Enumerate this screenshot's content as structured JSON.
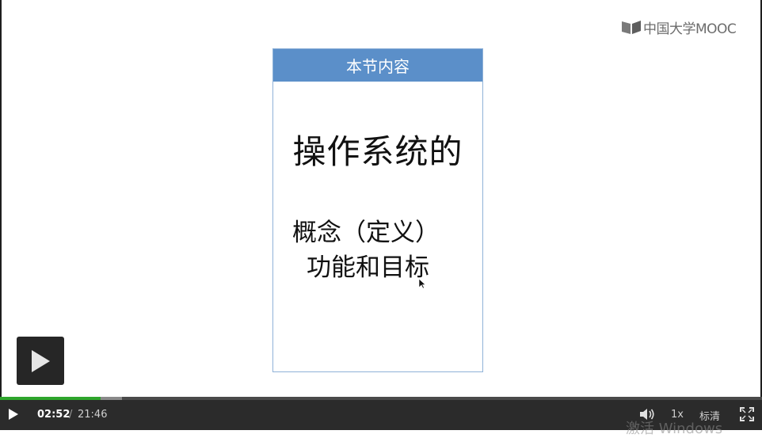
{
  "brand": {
    "logo_text": "中国大学MOOC"
  },
  "slide": {
    "header": "本节内容",
    "title": "操作系统的",
    "line1": "概念（定义）",
    "line2": "功能和目标"
  },
  "player": {
    "time_current": "02:52",
    "time_separator": "/",
    "time_total": "21:46",
    "progress_played": 0.132,
    "progress_buffered": 0.16,
    "speed": "1x",
    "quality": "标清",
    "accent_color": "#2ea52c"
  },
  "watermark": "激活 Windows",
  "icons": [
    "mooc-logo-icon",
    "play-icon",
    "volume-icon",
    "fullscreen-icon",
    "mouse-cursor-icon"
  ]
}
